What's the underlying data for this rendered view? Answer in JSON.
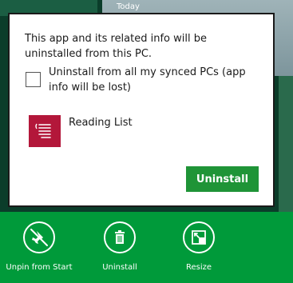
{
  "background": {
    "tile_label": "Today"
  },
  "dialog": {
    "message": "This app and its related info will be uninstalled from this PC.",
    "sync_checkbox": {
      "label": "Uninstall from all my synced PCs (app info will be lost)",
      "checked": false
    },
    "app": {
      "name": "Reading List",
      "icon": "reading-list-icon",
      "tile_color": "#b3173a"
    },
    "confirm_label": "Uninstall"
  },
  "app_bar": {
    "items": [
      {
        "label": "Unpin from Start",
        "icon": "unpin-icon"
      },
      {
        "label": "Uninstall",
        "icon": "trash-icon"
      },
      {
        "label": "Resize",
        "icon": "resize-icon"
      }
    ]
  },
  "colors": {
    "accent": "#009a3a",
    "button": "#1f9437",
    "dialog_border": "#1a1a1a",
    "start_background": "#0b3d2a"
  }
}
